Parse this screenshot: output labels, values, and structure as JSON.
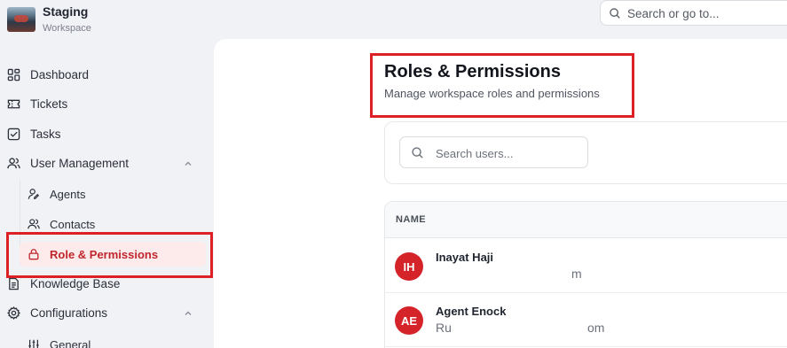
{
  "workspace": {
    "name": "Staging",
    "subtitle": "Workspace"
  },
  "top_search": {
    "placeholder": "Search or go to..."
  },
  "sidebar": {
    "items": [
      {
        "label": "Dashboard",
        "icon": "layout-grid-icon"
      },
      {
        "label": "Tickets",
        "icon": "ticket-icon"
      },
      {
        "label": "Tasks",
        "icon": "checkbox-icon"
      },
      {
        "label": "User Management",
        "icon": "users-icon",
        "expanded": true
      },
      {
        "label": "Knowledge Base",
        "icon": "document-icon"
      },
      {
        "label": "Configurations",
        "icon": "gear-icon",
        "expanded": true
      }
    ],
    "user_management_children": [
      {
        "label": "Agents",
        "icon": "user-pen-icon"
      },
      {
        "label": "Contacts",
        "icon": "users-icon"
      },
      {
        "label": "Role & Permissions",
        "icon": "lock-icon",
        "active": true
      }
    ],
    "configurations_children": [
      {
        "label": "General",
        "icon": "sliders-icon"
      }
    ]
  },
  "page": {
    "title": "Roles & Permissions",
    "subtitle": "Manage workspace roles and permissions"
  },
  "user_search": {
    "placeholder": "Search users..."
  },
  "table": {
    "columns": [
      "NAME"
    ],
    "rows": [
      {
        "initials": "IH",
        "name": "Inayat Haji",
        "email_visible": "m"
      },
      {
        "initials": "AE",
        "name": "Agent Enock",
        "email_visible_start": "Ru",
        "email_visible_end": "om"
      }
    ]
  },
  "colors": {
    "accent": "#dd1f26",
    "active_bg": "#fdeaea",
    "avatar": "#d5232a"
  }
}
